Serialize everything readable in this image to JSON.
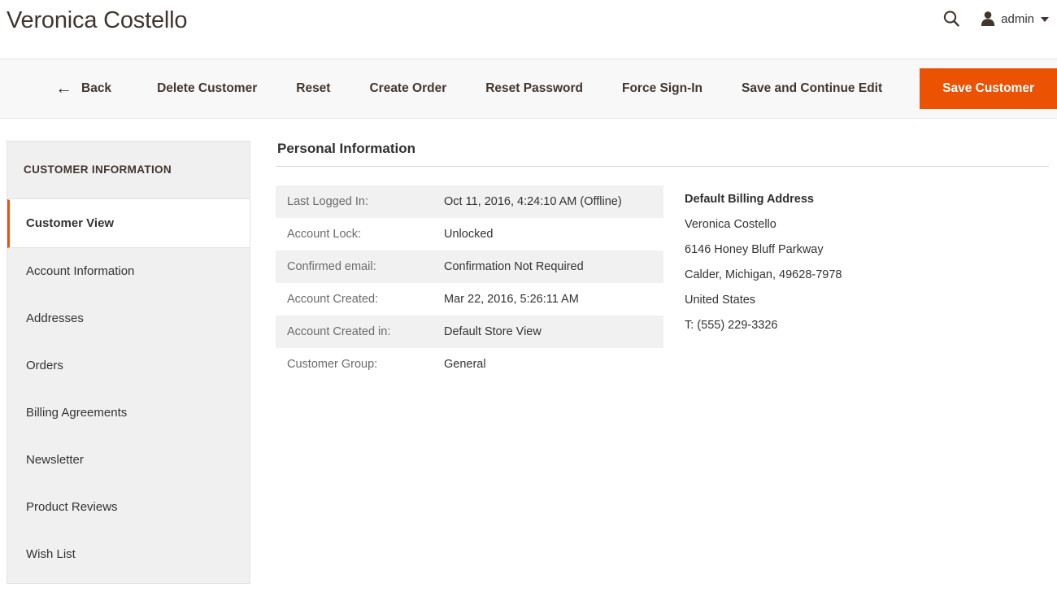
{
  "header": {
    "title": "Veronica Costello",
    "search_icon": "search-icon",
    "user_icon": "user-avatar-icon",
    "user_name": "admin",
    "caret_icon": "chevron-down-icon"
  },
  "toolbar": {
    "back_arrow": "←",
    "back_label": "Back",
    "delete_label": "Delete Customer",
    "reset_label": "Reset",
    "create_order_label": "Create Order",
    "reset_password_label": "Reset Password",
    "force_signin_label": "Force Sign-In",
    "save_continue_label": "Save and Continue Edit",
    "save_label": "Save Customer",
    "primary_color": "#eb5202"
  },
  "sidebar": {
    "title": "CUSTOMER INFORMATION",
    "active_accent_color": "#eb5202",
    "items": [
      {
        "label": "Customer View",
        "active": true
      },
      {
        "label": "Account Information",
        "active": false
      },
      {
        "label": "Addresses",
        "active": false
      },
      {
        "label": "Orders",
        "active": false
      },
      {
        "label": "Billing Agreements",
        "active": false
      },
      {
        "label": "Newsletter",
        "active": false
      },
      {
        "label": "Product Reviews",
        "active": false
      },
      {
        "label": "Wish List",
        "active": false
      }
    ]
  },
  "main": {
    "section_title": "Personal Information",
    "info_rows": [
      {
        "label": "Last Logged In:",
        "value": "Oct 11, 2016, 4:24:10 AM (Offline)"
      },
      {
        "label": "Account Lock:",
        "value": "Unlocked"
      },
      {
        "label": "Confirmed email:",
        "value": "Confirmation Not Required"
      },
      {
        "label": "Account Created:",
        "value": "Mar 22, 2016, 5:26:11 AM"
      },
      {
        "label": "Account Created in:",
        "value": "Default Store View"
      },
      {
        "label": "Customer Group:",
        "value": "General"
      }
    ],
    "billing_address": {
      "title": "Default Billing Address",
      "lines": [
        "Veronica Costello",
        "6146 Honey Bluff Parkway",
        "Calder, Michigan, 49628-7978",
        "United States",
        "T: (555) 229-3326"
      ]
    }
  }
}
